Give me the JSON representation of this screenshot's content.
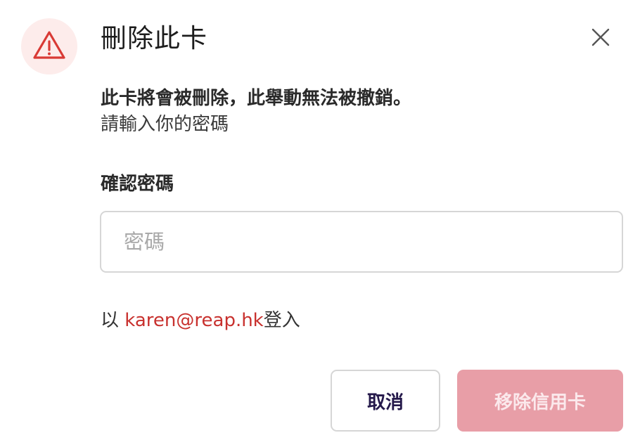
{
  "dialog": {
    "title": "刪除此卡",
    "description_bold": "此卡將會被刪除，此舉動無法被撤銷。",
    "description_normal": "請輸入你的密碼",
    "field_label": "確認密碼",
    "password_placeholder": "密碼",
    "password_value": "",
    "login_prefix": "以 ",
    "login_email": "karen@reap.hk",
    "login_suffix": "登入",
    "cancel_label": "取消",
    "remove_label": "移除信用卡"
  },
  "icons": {
    "warning": "warning-triangle-icon",
    "close": "close-icon"
  },
  "colors": {
    "warning_red": "#d93a35",
    "warning_bg": "#fdeceb",
    "email_red": "#c8312e",
    "remove_button_disabled": "#e89ea7",
    "cancel_text": "#24184a"
  },
  "state": {
    "remove_button_disabled": true
  }
}
